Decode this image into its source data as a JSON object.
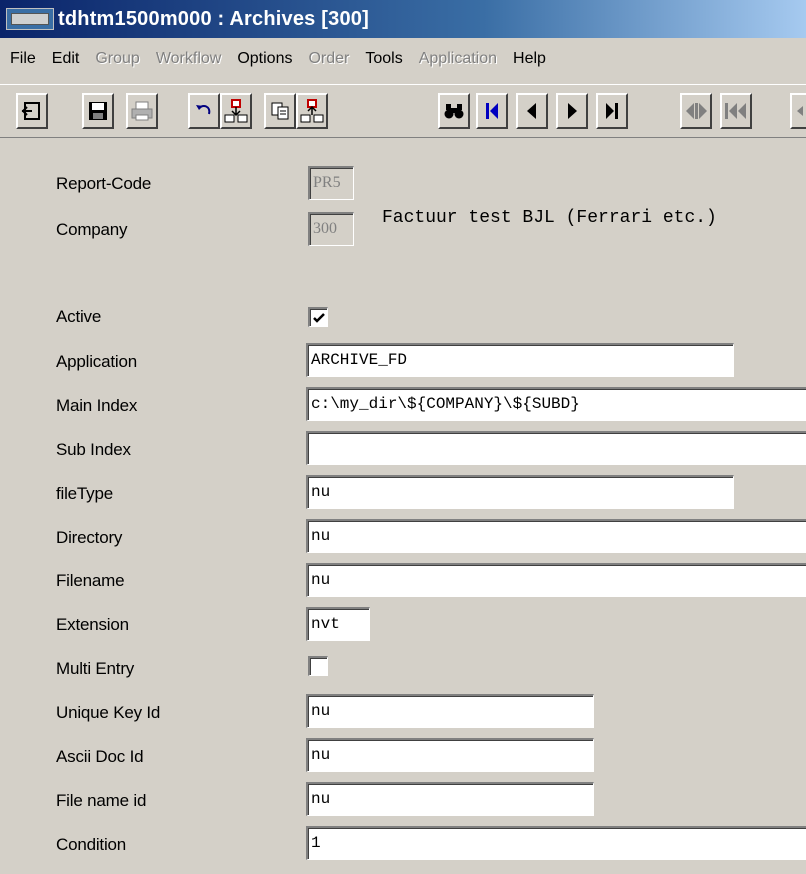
{
  "window": {
    "title": "tdhtm1500m000 : Archives [300]"
  },
  "menu": [
    {
      "label": "File",
      "enabled": true
    },
    {
      "label": "Edit",
      "enabled": true
    },
    {
      "label": "Group",
      "enabled": false
    },
    {
      "label": "Workflow",
      "enabled": false
    },
    {
      "label": "Options",
      "enabled": true
    },
    {
      "label": "Order",
      "enabled": false
    },
    {
      "label": "Tools",
      "enabled": true
    },
    {
      "label": "Application",
      "enabled": false
    },
    {
      "label": "Help",
      "enabled": true
    }
  ],
  "form": {
    "report_code": {
      "label": "Report-Code",
      "value": "PR5",
      "description": "Factuur test BJL (Ferrari etc.)"
    },
    "company": {
      "label": "Company",
      "value": "300"
    },
    "active": {
      "label": "Active",
      "checked": true
    },
    "application": {
      "label": "Application",
      "value": "ARCHIVE_FD"
    },
    "main_index": {
      "label": "Main Index",
      "value": "c:\\my_dir\\${COMPANY}\\${SUBD}"
    },
    "sub_index": {
      "label": "Sub Index",
      "value": ""
    },
    "file_type": {
      "label": "fileType",
      "value": "nu"
    },
    "directory": {
      "label": "Directory",
      "value": "nu"
    },
    "filename": {
      "label": "Filename",
      "value": "nu"
    },
    "extension": {
      "label": "Extension",
      "value": "nvt"
    },
    "multi_entry": {
      "label": "Multi Entry",
      "checked": false
    },
    "unique_key_id": {
      "label": "Unique Key Id",
      "value": "nu"
    },
    "ascii_doc_id": {
      "label": "Ascii Doc Id",
      "value": "nu"
    },
    "file_name_id": {
      "label": "File name id",
      "value": "nu"
    },
    "condition": {
      "label": "Condition",
      "value": "1"
    }
  }
}
